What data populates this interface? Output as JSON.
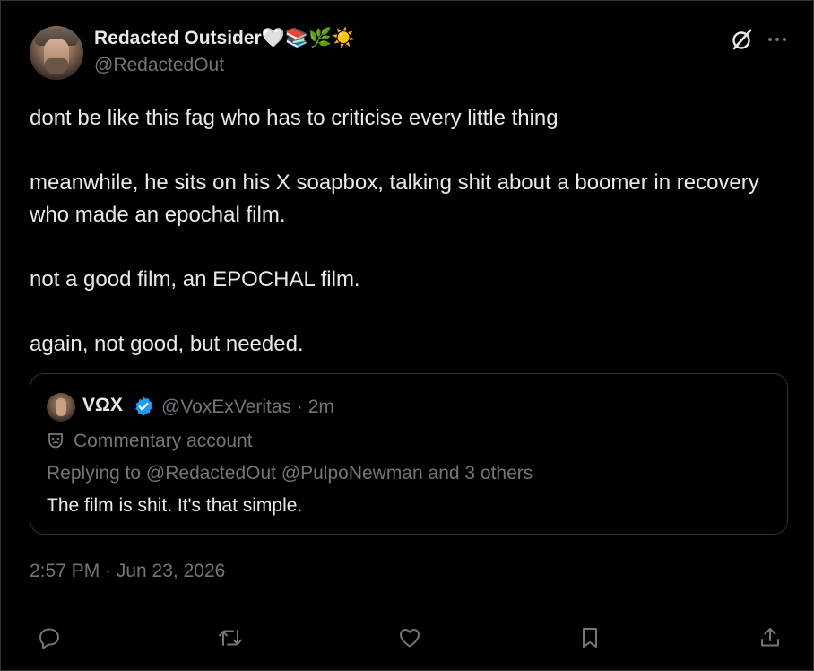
{
  "author": {
    "display_name": "Redacted Outsider🤍📚🌿☀️",
    "handle": "@RedactedOut"
  },
  "tweet": {
    "paragraphs": [
      "dont be like this fag who has to criticise every little thing",
      "meanwhile, he sits on his X soapbox, talking shit about a boomer in recovery who made an epochal film.",
      "not a good film, an EPOCHAL film.",
      "again, not good, but needed."
    ],
    "timestamp": "2:57 PM · Jun 23, 2026"
  },
  "quote": {
    "name": "VΩX",
    "meta": "@VoxExVeritas · 2m",
    "label": "Commentary account",
    "reply_prefix": "Replying to ",
    "reply_mentions": "@RedactedOut @PulpoNewman",
    "reply_suffix": " and 3 others",
    "text": "The film is shit. It's that simple."
  },
  "actions": [
    "reply-icon",
    "repost-icon",
    "like-icon",
    "bookmark-icon",
    "share-icon"
  ],
  "colors": {
    "background": "#000000",
    "text_primary": "#e7e9ea",
    "text_secondary": "#71767b",
    "border": "#2f3336",
    "verified": "#1d9bf0"
  }
}
